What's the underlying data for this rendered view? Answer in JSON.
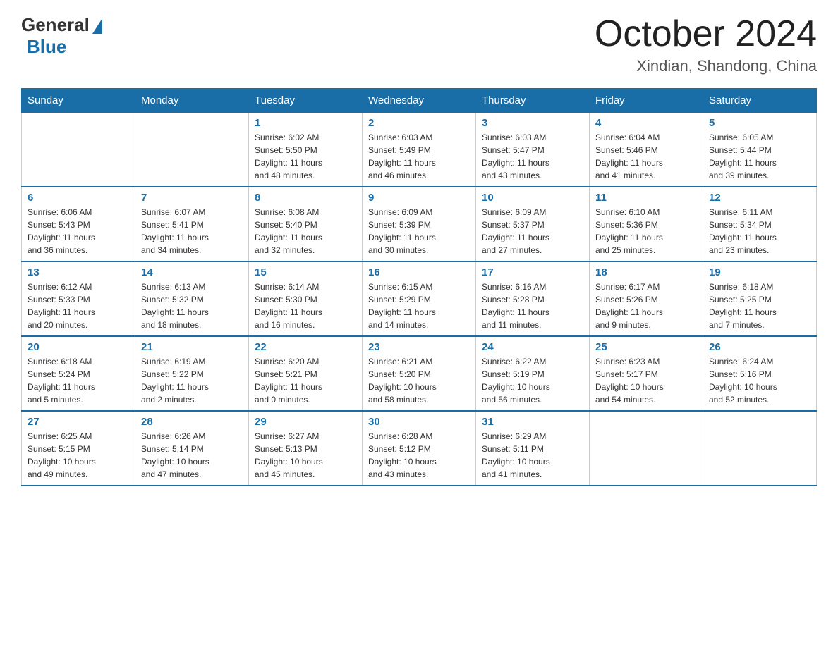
{
  "header": {
    "logo_general": "General",
    "logo_blue": "Blue",
    "title": "October 2024",
    "location": "Xindian, Shandong, China"
  },
  "days_of_week": [
    "Sunday",
    "Monday",
    "Tuesday",
    "Wednesday",
    "Thursday",
    "Friday",
    "Saturday"
  ],
  "weeks": [
    [
      {
        "day": "",
        "info": ""
      },
      {
        "day": "",
        "info": ""
      },
      {
        "day": "1",
        "info": "Sunrise: 6:02 AM\nSunset: 5:50 PM\nDaylight: 11 hours\nand 48 minutes."
      },
      {
        "day": "2",
        "info": "Sunrise: 6:03 AM\nSunset: 5:49 PM\nDaylight: 11 hours\nand 46 minutes."
      },
      {
        "day": "3",
        "info": "Sunrise: 6:03 AM\nSunset: 5:47 PM\nDaylight: 11 hours\nand 43 minutes."
      },
      {
        "day": "4",
        "info": "Sunrise: 6:04 AM\nSunset: 5:46 PM\nDaylight: 11 hours\nand 41 minutes."
      },
      {
        "day": "5",
        "info": "Sunrise: 6:05 AM\nSunset: 5:44 PM\nDaylight: 11 hours\nand 39 minutes."
      }
    ],
    [
      {
        "day": "6",
        "info": "Sunrise: 6:06 AM\nSunset: 5:43 PM\nDaylight: 11 hours\nand 36 minutes."
      },
      {
        "day": "7",
        "info": "Sunrise: 6:07 AM\nSunset: 5:41 PM\nDaylight: 11 hours\nand 34 minutes."
      },
      {
        "day": "8",
        "info": "Sunrise: 6:08 AM\nSunset: 5:40 PM\nDaylight: 11 hours\nand 32 minutes."
      },
      {
        "day": "9",
        "info": "Sunrise: 6:09 AM\nSunset: 5:39 PM\nDaylight: 11 hours\nand 30 minutes."
      },
      {
        "day": "10",
        "info": "Sunrise: 6:09 AM\nSunset: 5:37 PM\nDaylight: 11 hours\nand 27 minutes."
      },
      {
        "day": "11",
        "info": "Sunrise: 6:10 AM\nSunset: 5:36 PM\nDaylight: 11 hours\nand 25 minutes."
      },
      {
        "day": "12",
        "info": "Sunrise: 6:11 AM\nSunset: 5:34 PM\nDaylight: 11 hours\nand 23 minutes."
      }
    ],
    [
      {
        "day": "13",
        "info": "Sunrise: 6:12 AM\nSunset: 5:33 PM\nDaylight: 11 hours\nand 20 minutes."
      },
      {
        "day": "14",
        "info": "Sunrise: 6:13 AM\nSunset: 5:32 PM\nDaylight: 11 hours\nand 18 minutes."
      },
      {
        "day": "15",
        "info": "Sunrise: 6:14 AM\nSunset: 5:30 PM\nDaylight: 11 hours\nand 16 minutes."
      },
      {
        "day": "16",
        "info": "Sunrise: 6:15 AM\nSunset: 5:29 PM\nDaylight: 11 hours\nand 14 minutes."
      },
      {
        "day": "17",
        "info": "Sunrise: 6:16 AM\nSunset: 5:28 PM\nDaylight: 11 hours\nand 11 minutes."
      },
      {
        "day": "18",
        "info": "Sunrise: 6:17 AM\nSunset: 5:26 PM\nDaylight: 11 hours\nand 9 minutes."
      },
      {
        "day": "19",
        "info": "Sunrise: 6:18 AM\nSunset: 5:25 PM\nDaylight: 11 hours\nand 7 minutes."
      }
    ],
    [
      {
        "day": "20",
        "info": "Sunrise: 6:18 AM\nSunset: 5:24 PM\nDaylight: 11 hours\nand 5 minutes."
      },
      {
        "day": "21",
        "info": "Sunrise: 6:19 AM\nSunset: 5:22 PM\nDaylight: 11 hours\nand 2 minutes."
      },
      {
        "day": "22",
        "info": "Sunrise: 6:20 AM\nSunset: 5:21 PM\nDaylight: 11 hours\nand 0 minutes."
      },
      {
        "day": "23",
        "info": "Sunrise: 6:21 AM\nSunset: 5:20 PM\nDaylight: 10 hours\nand 58 minutes."
      },
      {
        "day": "24",
        "info": "Sunrise: 6:22 AM\nSunset: 5:19 PM\nDaylight: 10 hours\nand 56 minutes."
      },
      {
        "day": "25",
        "info": "Sunrise: 6:23 AM\nSunset: 5:17 PM\nDaylight: 10 hours\nand 54 minutes."
      },
      {
        "day": "26",
        "info": "Sunrise: 6:24 AM\nSunset: 5:16 PM\nDaylight: 10 hours\nand 52 minutes."
      }
    ],
    [
      {
        "day": "27",
        "info": "Sunrise: 6:25 AM\nSunset: 5:15 PM\nDaylight: 10 hours\nand 49 minutes."
      },
      {
        "day": "28",
        "info": "Sunrise: 6:26 AM\nSunset: 5:14 PM\nDaylight: 10 hours\nand 47 minutes."
      },
      {
        "day": "29",
        "info": "Sunrise: 6:27 AM\nSunset: 5:13 PM\nDaylight: 10 hours\nand 45 minutes."
      },
      {
        "day": "30",
        "info": "Sunrise: 6:28 AM\nSunset: 5:12 PM\nDaylight: 10 hours\nand 43 minutes."
      },
      {
        "day": "31",
        "info": "Sunrise: 6:29 AM\nSunset: 5:11 PM\nDaylight: 10 hours\nand 41 minutes."
      },
      {
        "day": "",
        "info": ""
      },
      {
        "day": "",
        "info": ""
      }
    ]
  ]
}
